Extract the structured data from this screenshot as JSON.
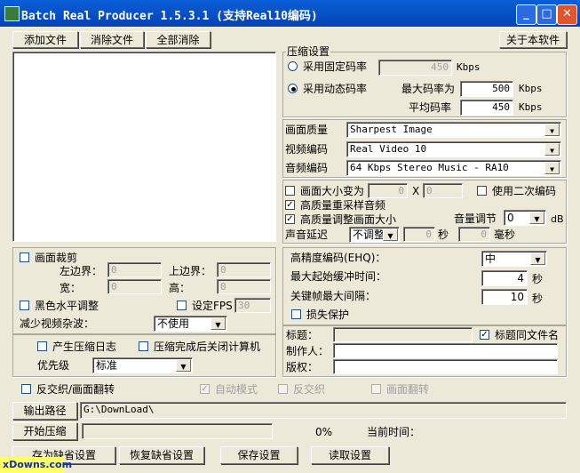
{
  "window": {
    "title": "Batch Real Producer 1.5.3.1 (支持Real10编码)",
    "min_icon": "minimize-icon",
    "max_icon": "maximize-icon",
    "close_icon": "close-icon"
  },
  "toolbar": {
    "add_files": "添加文件",
    "remove_file": "消除文件",
    "remove_all": "全部消除",
    "about": "关于本软件"
  },
  "compression": {
    "group_title": "压缩设置",
    "fixed_bitrate_label": "采用固定码率",
    "fixed_bitrate_value": "450",
    "fixed_unit": "Kbps",
    "variable_bitrate_label": "采用动态码率",
    "max_bitrate_label": "最大码率为",
    "max_bitrate_value": "500",
    "max_unit": "Kbps",
    "avg_bitrate_label": "平均码率",
    "avg_bitrate_value": "450",
    "avg_unit": "Kbps",
    "selected_mode": "variable"
  },
  "codec": {
    "quality_label": "画面质量",
    "quality_value": "Sharpest Image",
    "video_label": "视频编码",
    "video_value": "Real Video 10",
    "audio_label": "音频编码",
    "audio_value": "64 Kbps Stereo Music - RA10"
  },
  "resize": {
    "resize_label": "画面大小变为",
    "width": "0",
    "x": "X",
    "height": "0",
    "two_pass_label": "使用二次编码",
    "hq_resample_label": "高质量重采样音频",
    "hq_resize_label": "高质量调整画面大小",
    "volume_label": "音量调节",
    "volume_value": "0",
    "volume_unit": "dB",
    "delay_label": "声音延迟",
    "delay_mode": "不调整",
    "delay_sec": "0",
    "sec_unit": "秒",
    "delay_ms": "0",
    "ms_unit": "毫秒"
  },
  "crop": {
    "crop_label": "画面裁剪",
    "left_label": "左边界：",
    "left": "0",
    "top_label": "上边界：",
    "top": "0",
    "width_label": "宽：",
    "width": "0",
    "height_label": "高：",
    "height": "0",
    "bw_label": "黑色水平调整",
    "fps_label": "设定FPS",
    "fps": "30",
    "noise_label": "减少视频杂波：",
    "noise_value": "不使用"
  },
  "ehq": {
    "ehq_label": "高精度编码(EHQ)：",
    "ehq_value": "中",
    "preroll_label": "最大起始缓冲时间：",
    "preroll": "4",
    "preroll_unit": "秒",
    "keyframe_label": "关键帧最大间隔：",
    "keyframe": "10",
    "keyframe_unit": "秒",
    "loss_label": "损失保护"
  },
  "meta": {
    "title_label": "标题：",
    "title_value": "",
    "same_as_file_label": "标题同文件名",
    "author_label": "制作人：",
    "author_value": "",
    "copyright_label": "版权：",
    "copyright_value": ""
  },
  "options": {
    "log_label": "产生压缩日志",
    "shutdown_label": "压缩完成后关闭计算机",
    "priority_label": "优先级",
    "priority_value": "标准"
  },
  "deinterlace": {
    "main_label": "反交织/画面翻转",
    "auto_label": "自动模式",
    "deint_label": "反交织",
    "flip_label": "画面翻转"
  },
  "output": {
    "path_button": "输出路径",
    "path_value": "G:\\DownLoad\\",
    "start_button": "开始压缩",
    "progress_percent": "0%",
    "progress_fraction": 0,
    "current_time_label": "当前时间："
  },
  "bottom": {
    "save_default": "存为缺省设置",
    "restore_default": "恢复缺省设置",
    "save_settings": "保存设置",
    "load_settings": "读取设置"
  },
  "watermark": "xDowns.com"
}
